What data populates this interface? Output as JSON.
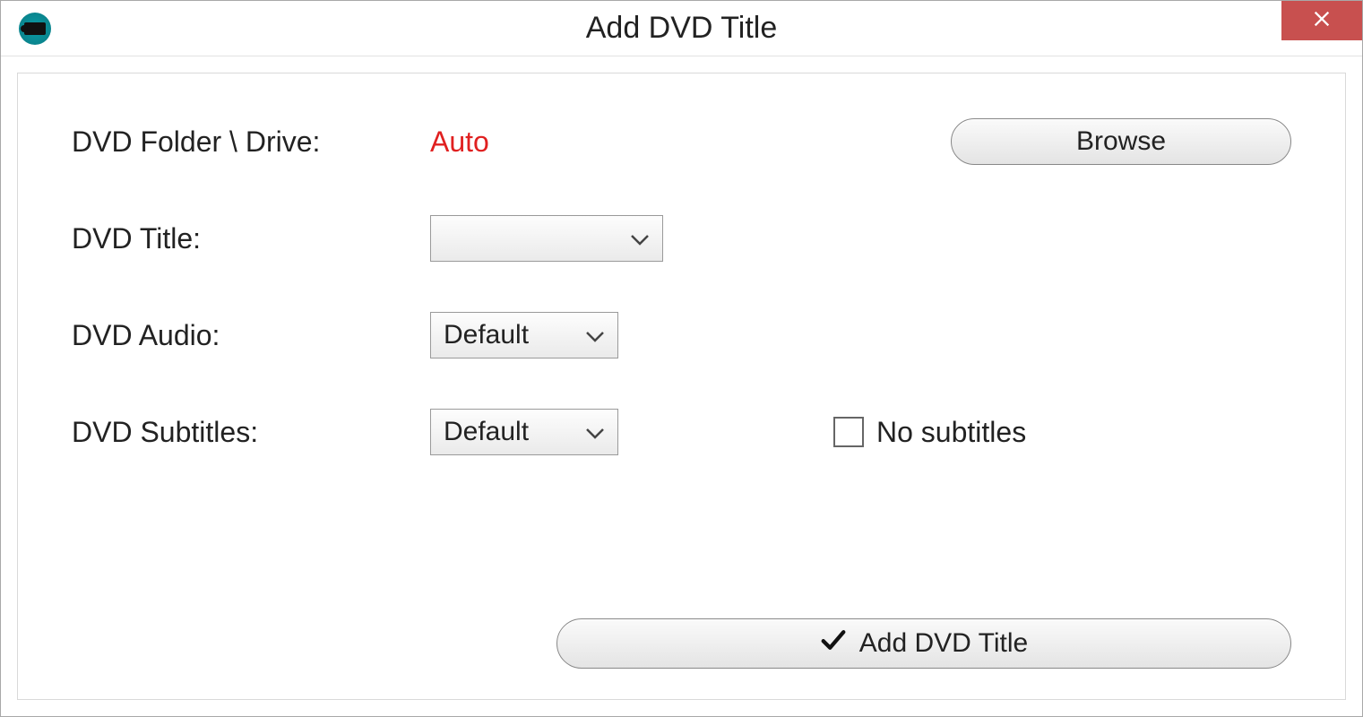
{
  "window": {
    "title": "Add DVD Title"
  },
  "form": {
    "folder_label": "DVD Folder \\ Drive:",
    "folder_value": "Auto",
    "browse_label": "Browse",
    "title_label": "DVD Title:",
    "title_value": "",
    "audio_label": "DVD Audio:",
    "audio_value": "Default",
    "subtitles_label": "DVD Subtitles:",
    "subtitles_value": "Default",
    "no_subtitles_label": "No subtitles"
  },
  "buttons": {
    "add_label": "Add DVD Title"
  }
}
